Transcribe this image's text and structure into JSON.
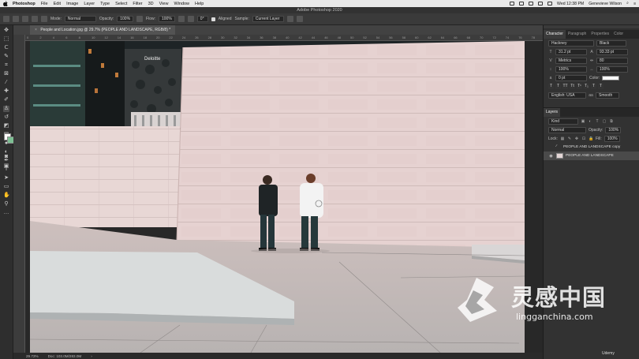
{
  "menubar": {
    "app_name": "Photoshop",
    "items": [
      "File",
      "Edit",
      "Image",
      "Layer",
      "Type",
      "Select",
      "Filter",
      "3D",
      "View",
      "Window",
      "Help"
    ],
    "window_title": "Adobe Photoshop 2020",
    "clock": "Wed 12:38 PM",
    "user": "Genevieve Wilson"
  },
  "options": {
    "mode_label": "Mode:",
    "mode_value": "Normal",
    "opacity_label": "Opacity:",
    "opacity_value": "100%",
    "flow_label": "Flow:",
    "flow_value": "100%",
    "angle_value": "0°",
    "aligned_label": "Aligned",
    "sample_label": "Sample:",
    "sample_value": "Current Layer"
  },
  "document": {
    "tab_title": "People and Location.jpg @ 29.7% (PEOPLE AND LANDSCAPE, RGB/8) *",
    "ruler_ticks": [
      "0",
      "2",
      "4",
      "6",
      "8",
      "10",
      "12",
      "14",
      "16",
      "18",
      "20",
      "22",
      "24",
      "26",
      "28",
      "30",
      "32",
      "34",
      "36",
      "38",
      "40",
      "42",
      "44",
      "46",
      "48",
      "50",
      "52",
      "54",
      "56",
      "58",
      "60",
      "62",
      "64",
      "66",
      "68",
      "70",
      "72",
      "74",
      "76",
      "78"
    ],
    "building_sign": "Deloitte",
    "zoom": "29.72%",
    "doc_size": "Doc: 103.0M/283.0M"
  },
  "panels": {
    "tabs": [
      "Character",
      "Paragraph",
      "Properties",
      "Color"
    ],
    "character": {
      "font_family": "Hackney",
      "font_style": "Black",
      "font_size": "31.2 pt",
      "leading": "93.33 pt",
      "kerning": "Metrics",
      "tracking": "80",
      "vscale": "100%",
      "hscale": "100%",
      "baseline": "0 pt",
      "color_label": "Color:",
      "language": "English: USA",
      "antialias": "Smooth"
    },
    "layers": {
      "title": "Layers",
      "kind_filter": "Kind",
      "blend_mode": "Normal",
      "opacity_label": "Opacity:",
      "opacity_value": "100%",
      "lock_label": "Lock:",
      "fill_label": "Fill:",
      "fill_value": "100%",
      "items": [
        {
          "name": "PEOPLE AND LANDSCAPE copy",
          "selected": false,
          "visible": false
        },
        {
          "name": "PEOPLE AND LANDSCAPE",
          "selected": true,
          "visible": true
        }
      ]
    }
  },
  "watermark": {
    "chinese": "灵感中国",
    "english": "lingganchina.com",
    "udemy": "Udemy"
  },
  "colors": {
    "foreground": "#ffffff",
    "background": "#7dbf93",
    "wall": "#e7d3d2",
    "ground": "#c2b9b6"
  }
}
